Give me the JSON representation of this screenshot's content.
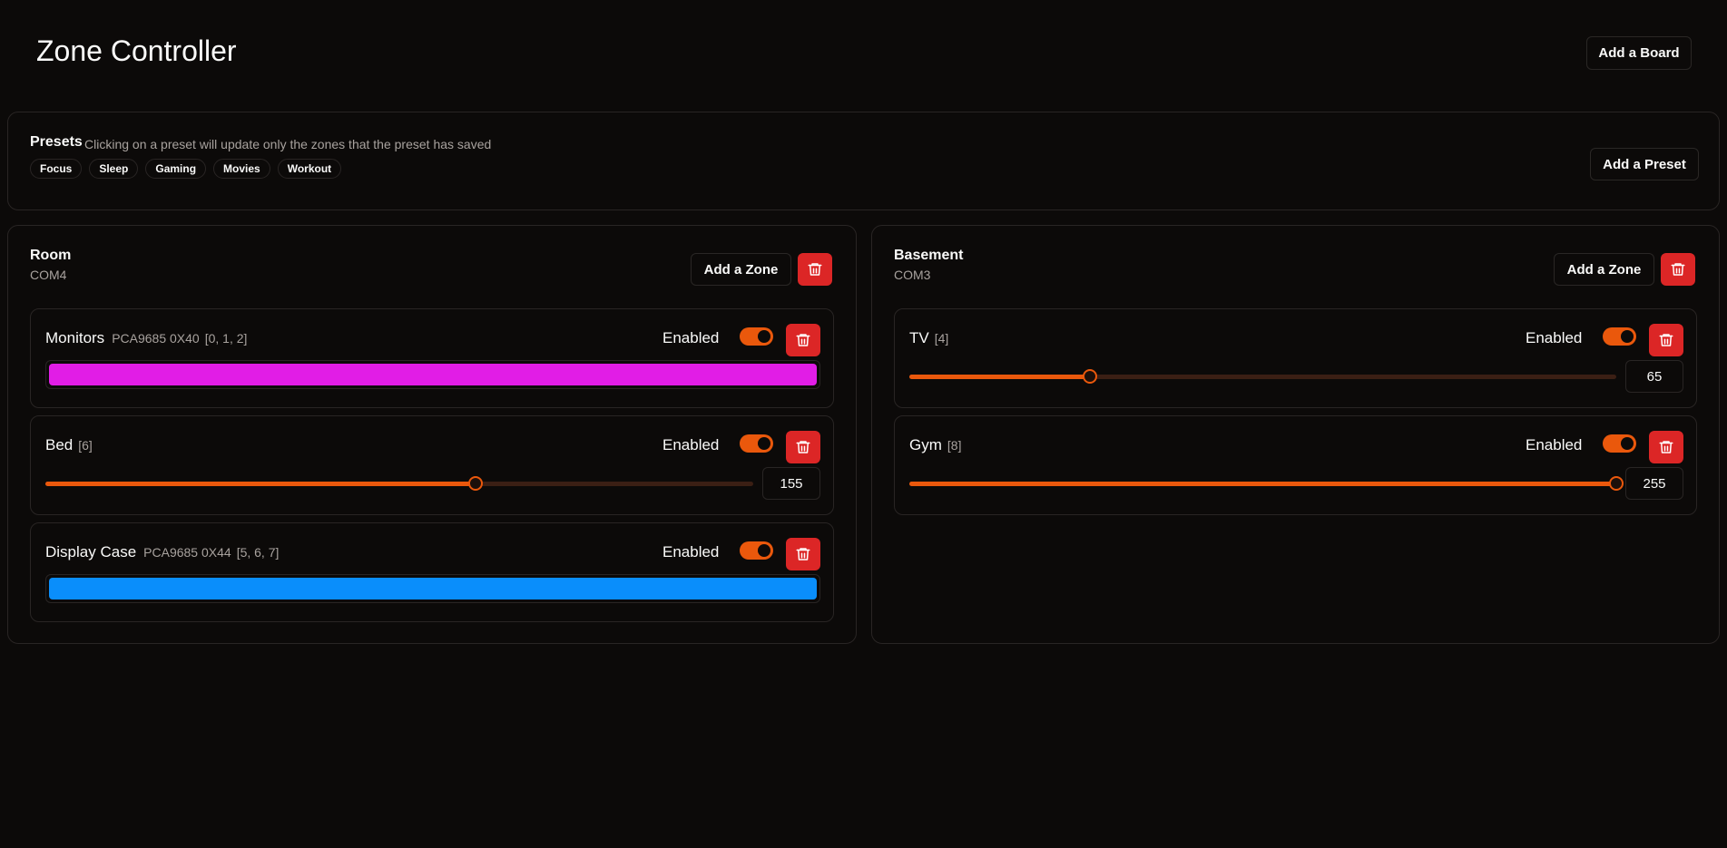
{
  "header": {
    "title": "Zone Controller",
    "add_board_label": "Add a Board"
  },
  "presets": {
    "title": "Presets",
    "description": "Clicking on a preset will update only the zones that the preset has saved",
    "add_preset_label": "Add a Preset",
    "items": [
      "Focus",
      "Sleep",
      "Gaming",
      "Movies",
      "Workout"
    ]
  },
  "colors": {
    "accent": "#ea580c",
    "danger": "#dc2626",
    "background": "#0c0a09"
  },
  "boards": [
    {
      "name": "Room",
      "port": "COM4",
      "add_zone_label": "Add a Zone",
      "delete_icon": "trash-icon",
      "zones": [
        {
          "name": "Monitors",
          "meta": "PCA9685 0X40",
          "pins": "[0, 1, 2]",
          "enabled_label": "Enabled",
          "enabled": true,
          "type": "color",
          "color": "#e11de6"
        },
        {
          "name": "Bed",
          "meta": "",
          "pins": "[6]",
          "enabled_label": "Enabled",
          "enabled": true,
          "type": "brightness",
          "value": "155",
          "level": 155,
          "max": 255
        },
        {
          "name": "Display Case",
          "meta": "PCA9685 0X44",
          "pins": "[5, 6, 7]",
          "enabled_label": "Enabled",
          "enabled": true,
          "type": "color",
          "color": "#0a8efb"
        }
      ]
    },
    {
      "name": "Basement",
      "port": "COM3",
      "add_zone_label": "Add a Zone",
      "delete_icon": "trash-icon",
      "zones": [
        {
          "name": "TV",
          "meta": "",
          "pins": "[4]",
          "enabled_label": "Enabled",
          "enabled": true,
          "type": "brightness",
          "value": "65",
          "level": 65,
          "max": 255
        },
        {
          "name": "Gym",
          "meta": "",
          "pins": "[8]",
          "enabled_label": "Enabled",
          "enabled": true,
          "type": "brightness",
          "value": "255",
          "level": 255,
          "max": 255
        }
      ]
    }
  ]
}
